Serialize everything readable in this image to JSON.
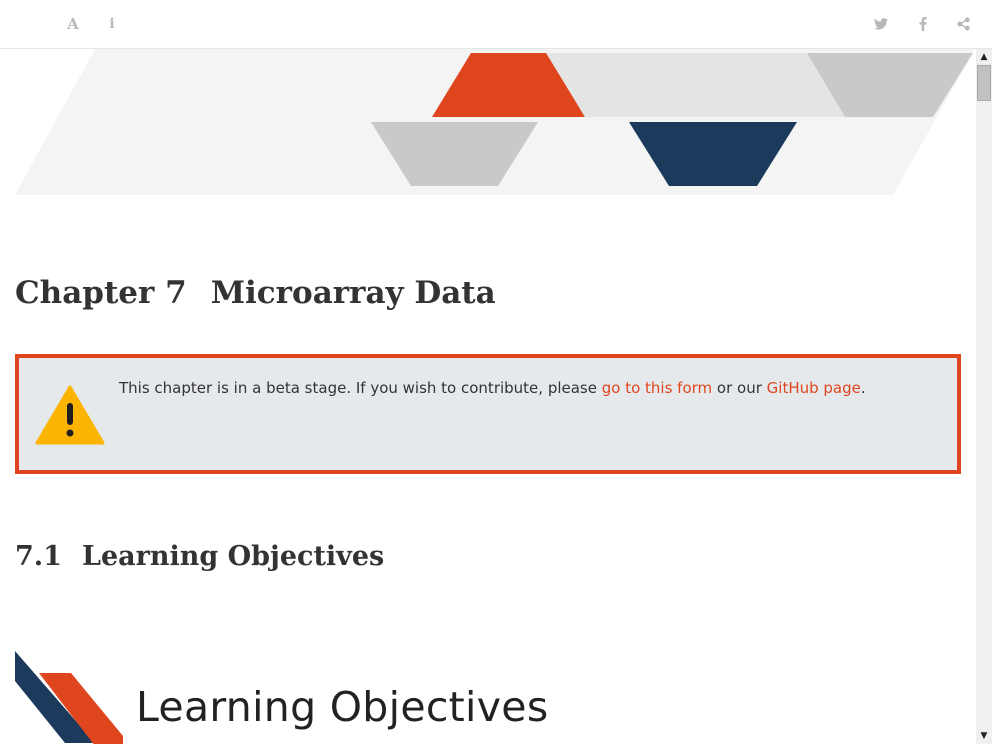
{
  "toolbar": {
    "font_icon": "font-size-icon",
    "font_glyph": "A",
    "info_icon": "info-icon",
    "info_glyph": "i",
    "twitter_icon": "twitter-icon",
    "facebook_icon": "facebook-icon",
    "share_icon": "share-icon"
  },
  "chapter": {
    "number": "Chapter 7",
    "title": "Microarray Data"
  },
  "callout": {
    "icon": "warning-icon",
    "text_before": "This chapter is in a beta stage. If you wish to contribute, please ",
    "link1": "go to this form",
    "text_middle": " or our ",
    "link2": "GitHub page",
    "text_after": "."
  },
  "section": {
    "number": "7.1",
    "title": "Learning Objectives"
  },
  "lo_banner": {
    "text": "Learning Objectives"
  },
  "colors": {
    "accent": "#e0461e",
    "navy": "#1b3a5c",
    "callout_bg": "#e6e9ec",
    "warning": "#fbb400"
  },
  "scrollbar": {
    "up_icon": "scroll-up-arrow-icon",
    "down_icon": "scroll-down-arrow-icon"
  }
}
